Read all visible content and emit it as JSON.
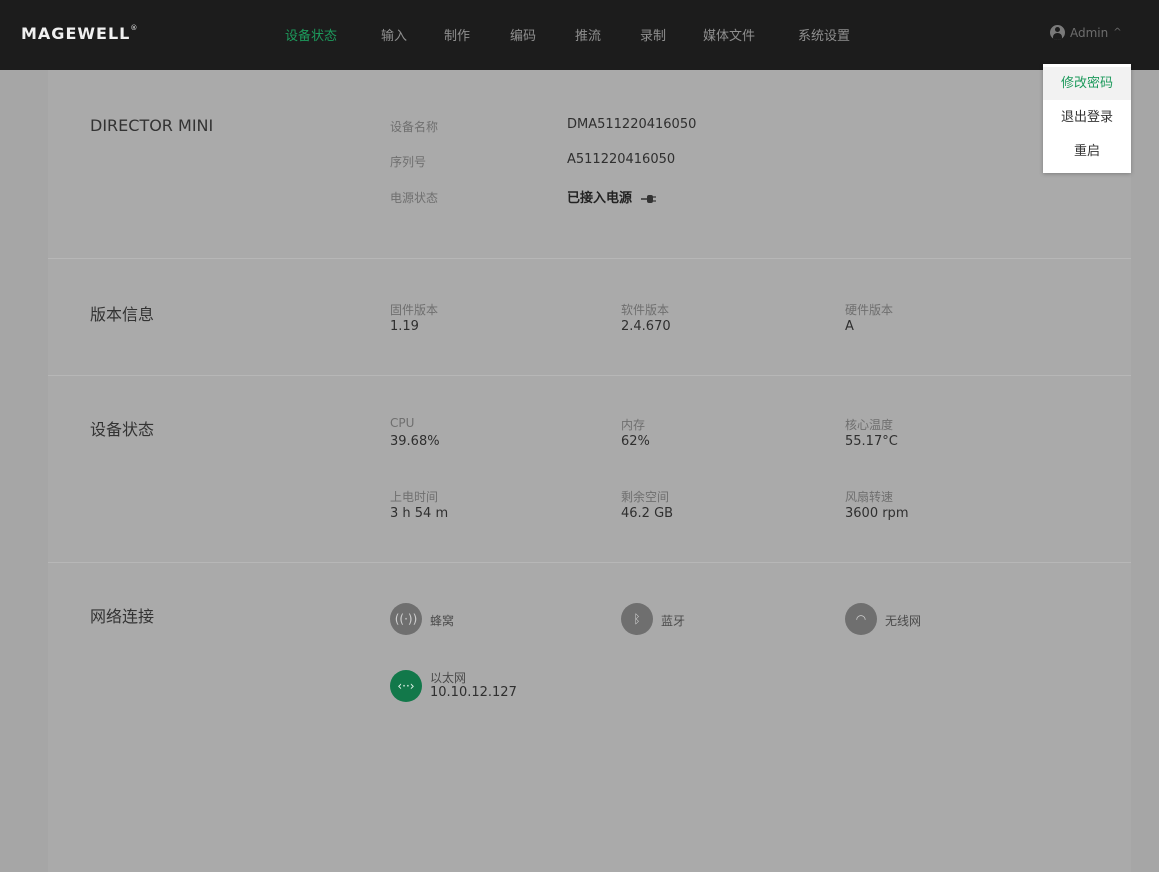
{
  "header": {
    "logo": "MAGEWELL",
    "logo_mark": "®",
    "nav": [
      {
        "label": "设备状态",
        "active": true
      },
      {
        "label": "输入",
        "active": false
      },
      {
        "label": "制作",
        "active": false
      },
      {
        "label": "编码",
        "active": false
      },
      {
        "label": "推流",
        "active": false
      },
      {
        "label": "录制",
        "active": false
      },
      {
        "label": "媒体文件",
        "active": false
      },
      {
        "label": "系统设置",
        "active": false
      }
    ],
    "user": "Admin",
    "user_caret": "^"
  },
  "user_menu": {
    "items": [
      "修改密码",
      "退出登录",
      "重启"
    ],
    "highlighted": "修改密码"
  },
  "device": {
    "title": "DIRECTOR MINI",
    "fields": [
      {
        "label": "设备名称",
        "value": "DMA511220416050"
      },
      {
        "label": "序列号",
        "value": "A511220416050"
      },
      {
        "label": "电源状态",
        "value": "已接入电源"
      }
    ],
    "power_icon": "plug-icon"
  },
  "version": {
    "title": "版本信息",
    "fields": [
      {
        "label": "固件版本",
        "value": "1.19"
      },
      {
        "label": "软件版本",
        "value": "2.4.670"
      },
      {
        "label": "硬件版本",
        "value": "A"
      }
    ]
  },
  "status": {
    "title": "设备状态",
    "fields": [
      {
        "label": "CPU",
        "value": "39.68%"
      },
      {
        "label": "内存",
        "value": "62%"
      },
      {
        "label": "核心温度",
        "value": "55.17°C"
      },
      {
        "label": "上电时间",
        "value": "3 h 54 m"
      },
      {
        "label": "剩余空间",
        "value": "46.2 GB"
      },
      {
        "label": "风扇转速",
        "value": "3600 rpm"
      }
    ]
  },
  "network": {
    "title": "网络连接",
    "items": [
      {
        "name": "蜂窝",
        "icon": "cellular-icon",
        "glyph": "((·))",
        "connected": false
      },
      {
        "name": "蓝牙",
        "icon": "bluetooth-icon",
        "glyph": "ᛒ",
        "connected": false
      },
      {
        "name": "无线网",
        "icon": "wifi-icon",
        "glyph": "◠",
        "connected": false
      },
      {
        "name": "以太网",
        "icon": "ethernet-icon",
        "glyph": "‹··›",
        "connected": true,
        "ip": "10.10.12.127"
      }
    ]
  },
  "colors": {
    "accent": "#1d9a5c",
    "connected": "#12784a",
    "topbar": "#1c1c1c",
    "overlay": "#aaaaaa"
  }
}
